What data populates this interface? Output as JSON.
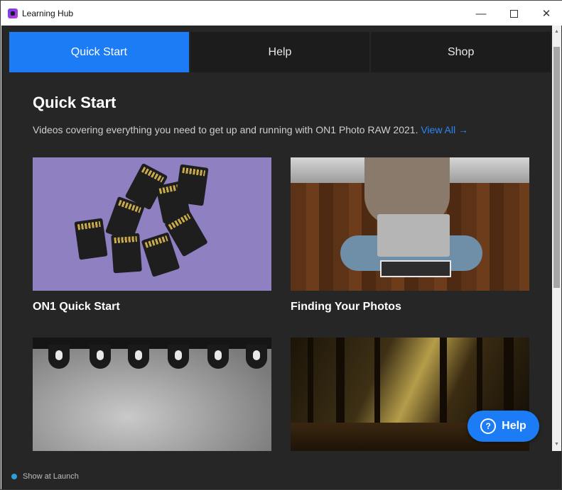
{
  "window": {
    "title": "Learning Hub",
    "minimize": "—",
    "maximize": "",
    "close": "✕"
  },
  "tabs": [
    {
      "label": "Quick Start",
      "active": true
    },
    {
      "label": "Help",
      "active": false
    },
    {
      "label": "Shop",
      "active": false
    }
  ],
  "section": {
    "heading": "Quick Start",
    "subtitle": "Videos covering everything you need to get up and running with ON1 Photo RAW 2021.",
    "view_all": "View All →"
  },
  "cards": [
    {
      "title": "ON1 Quick Start",
      "image": "sd-cards-on-purple"
    },
    {
      "title": "Finding Your Photos",
      "image": "laptop-on-wood-floor"
    },
    {
      "title": "",
      "image": "water-drops"
    },
    {
      "title": "",
      "image": "forest-sunrays"
    }
  ],
  "help_button": {
    "icon": "?",
    "label": "Help"
  },
  "footer": {
    "show_at_launch": "Show at Launch"
  },
  "colors": {
    "accent": "#1b7cf5",
    "background": "#262626",
    "tab_bg": "#1c1c1c",
    "link": "#2b86f7"
  }
}
